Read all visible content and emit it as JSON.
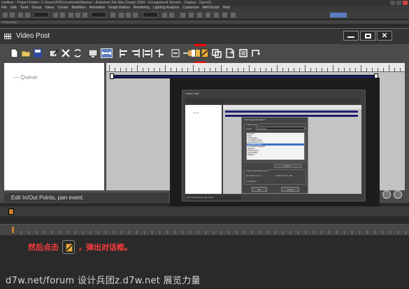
{
  "max_app": {
    "titlebar_text": "Untitled   :: Project Folder: C:\\Users\\ZH\\Documents\\3dsmax   ::   Autodesk 3ds Max Design 2009  -  Unregistered Version   ::   Display : OpenGL",
    "menu_items": [
      "File",
      "Edit",
      "Tools",
      "Group",
      "Views",
      "Create",
      "Modifiers",
      "Animation",
      "Graph Editors",
      "Rendering",
      "Lighting Analysis",
      "Customize",
      "MAXScript",
      "Help"
    ],
    "viewport_label": "Perspective"
  },
  "video_post": {
    "title": "Video Post",
    "queue_label": "Queue",
    "status_text": "Edit In/Out Points, pan event.",
    "toolbar_icons": [
      "new-sequence-icon",
      "open-sequence-icon",
      "save-sequence-icon",
      "edit-current-event-icon",
      "delete-current-event-icon",
      "swap-events-icon",
      "execute-sequence-icon",
      "edit-range-bar-icon",
      "align-left-icon",
      "align-right-icon",
      "make-same-size-icon",
      "abut-selected-icon",
      "zoom-extents-icon",
      "add-scene-event-icon",
      "add-image-input-event-icon",
      "add-image-filter-event-icon",
      "add-image-layer-event-icon",
      "add-image-output-event-icon",
      "add-external-event-icon",
      "add-loop-event-icon"
    ],
    "highlighted_tool": "add-image-filter-event-icon"
  },
  "overlay": {
    "window_title": "Video Post",
    "queue_label": "Queue",
    "status_text": "Edit In/Out Points, pan event.",
    "dialog": {
      "title": "Add Image Filter Event",
      "filter_plugin_label": "Filter Plug-In",
      "label_caption": "Label:",
      "label_value": "Unnamed",
      "filters": [
        "Contrast",
        "Fade",
        "Image Alpha",
        "Lens Effects Flare",
        "Lens Effects Focus",
        "Lens Effects Glow",
        "Lens Effects Highlight",
        "Negative",
        "Pseudo Alpha",
        "Simple Wipe",
        "Starfield"
      ],
      "selected_filter": "Lens Effects Glow",
      "setup_label": "Setup...",
      "params_label": "Video Post Parameters",
      "vp_start_label": "VP Start Time:",
      "vp_start_value": "0",
      "vp_end_label": "VP End Time:",
      "vp_end_value": "100",
      "enabled_label": "Enabled",
      "ok_label": "OK",
      "cancel_label": "Cancel"
    }
  },
  "caption": {
    "before": "然后点击",
    "after": "，弹出对话框。",
    "color": "#ff3b3b"
  },
  "watermark": "d7w.net/forum 设计兵团z.d7w.net 展览力量"
}
